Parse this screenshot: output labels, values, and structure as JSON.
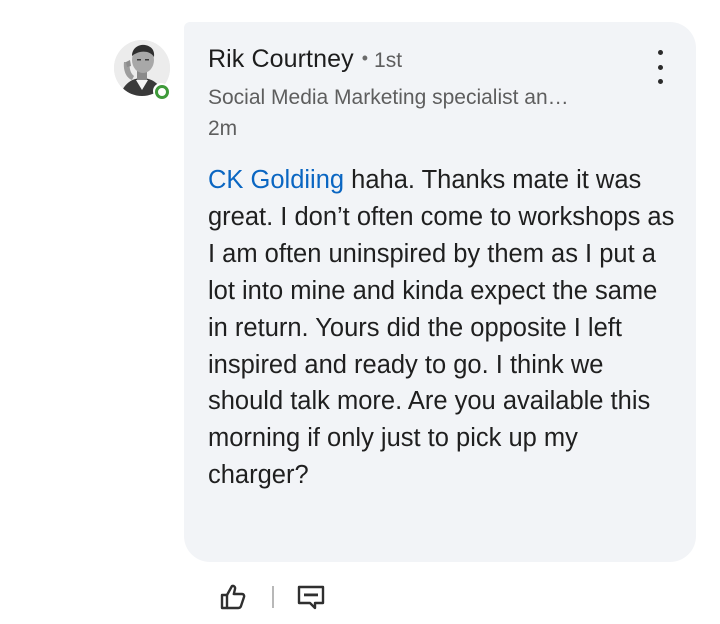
{
  "author": {
    "name": "Rik Courtney",
    "separator": "•",
    "degree": "1st",
    "headline": "Social Media Marketing specialist an…",
    "time": "2m",
    "online": true
  },
  "comment": {
    "mention": "CK Goldiing",
    "text": " haha. Thanks mate it was great. I don’t often come to workshops as I am often uninspired by them as I put a lot into mine and kinda expect the same in return. Yours did the opposite I left inspired and ready to go. I think we should talk more. Are you available this morning if only just to pick up my charger?"
  },
  "icons": {
    "avatar": "profile-photo",
    "presence": "online-status-icon",
    "more": "more-options-vertical-icon",
    "like": "thumbs-up-icon",
    "reply": "reply-comment-icon"
  },
  "colors": {
    "bubble_bg": "#f2f4f7",
    "mention": "#0a66c2",
    "online": "#3f9a3a",
    "text": "#1f1f1f",
    "secondary_text": "#5e5e5e"
  }
}
